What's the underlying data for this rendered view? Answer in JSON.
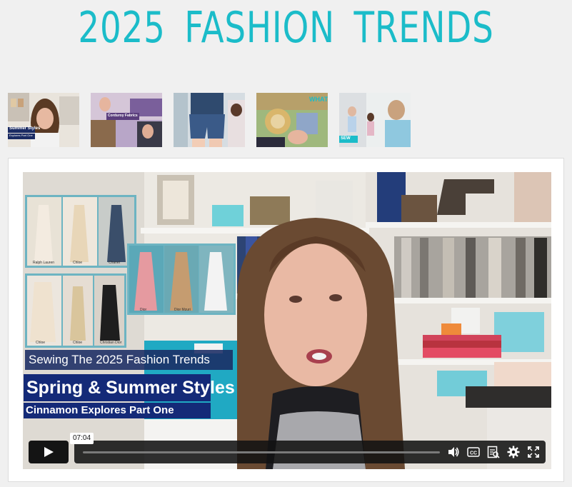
{
  "header": {
    "title": "2025 FASHION TRENDS",
    "title_color": "#1bbcc9"
  },
  "thumbnails": [
    {
      "name": "Sewing The 2025 Fashion Trends - Summer Styles"
    },
    {
      "name": "Corduroy Fabrics video"
    },
    {
      "name": "Denim shorts video"
    },
    {
      "name": "Embroidery video"
    },
    {
      "name": "Doll fashion video"
    }
  ],
  "thumbnail_texts": {
    "t1_a": "Summer Styles",
    "t1_b": "Explores Part One",
    "t2_a": "Corduroy Fabrics",
    "t4_a": "WHAT",
    "t5_a": "SEW"
  },
  "video": {
    "banner_line1": "Sewing The 2025 Fashion Trends",
    "banner_line2": "Spring & Summer Styles",
    "banner_line3": "Cinnamon Explores Part One",
    "captions": [
      "Ralph Lauren",
      "Chloe",
      "Chanel",
      "Dior",
      "Dior Mzuri",
      "Chloe",
      "Chloe",
      "Christian Dior"
    ],
    "banner_color": "#142a78"
  },
  "controls": {
    "time_tooltip": "07:04",
    "progress": 0,
    "icons": [
      "play-icon",
      "volume-icon",
      "closed-captions-icon",
      "transcript-icon",
      "settings-icon",
      "fullscreen-icon"
    ]
  }
}
